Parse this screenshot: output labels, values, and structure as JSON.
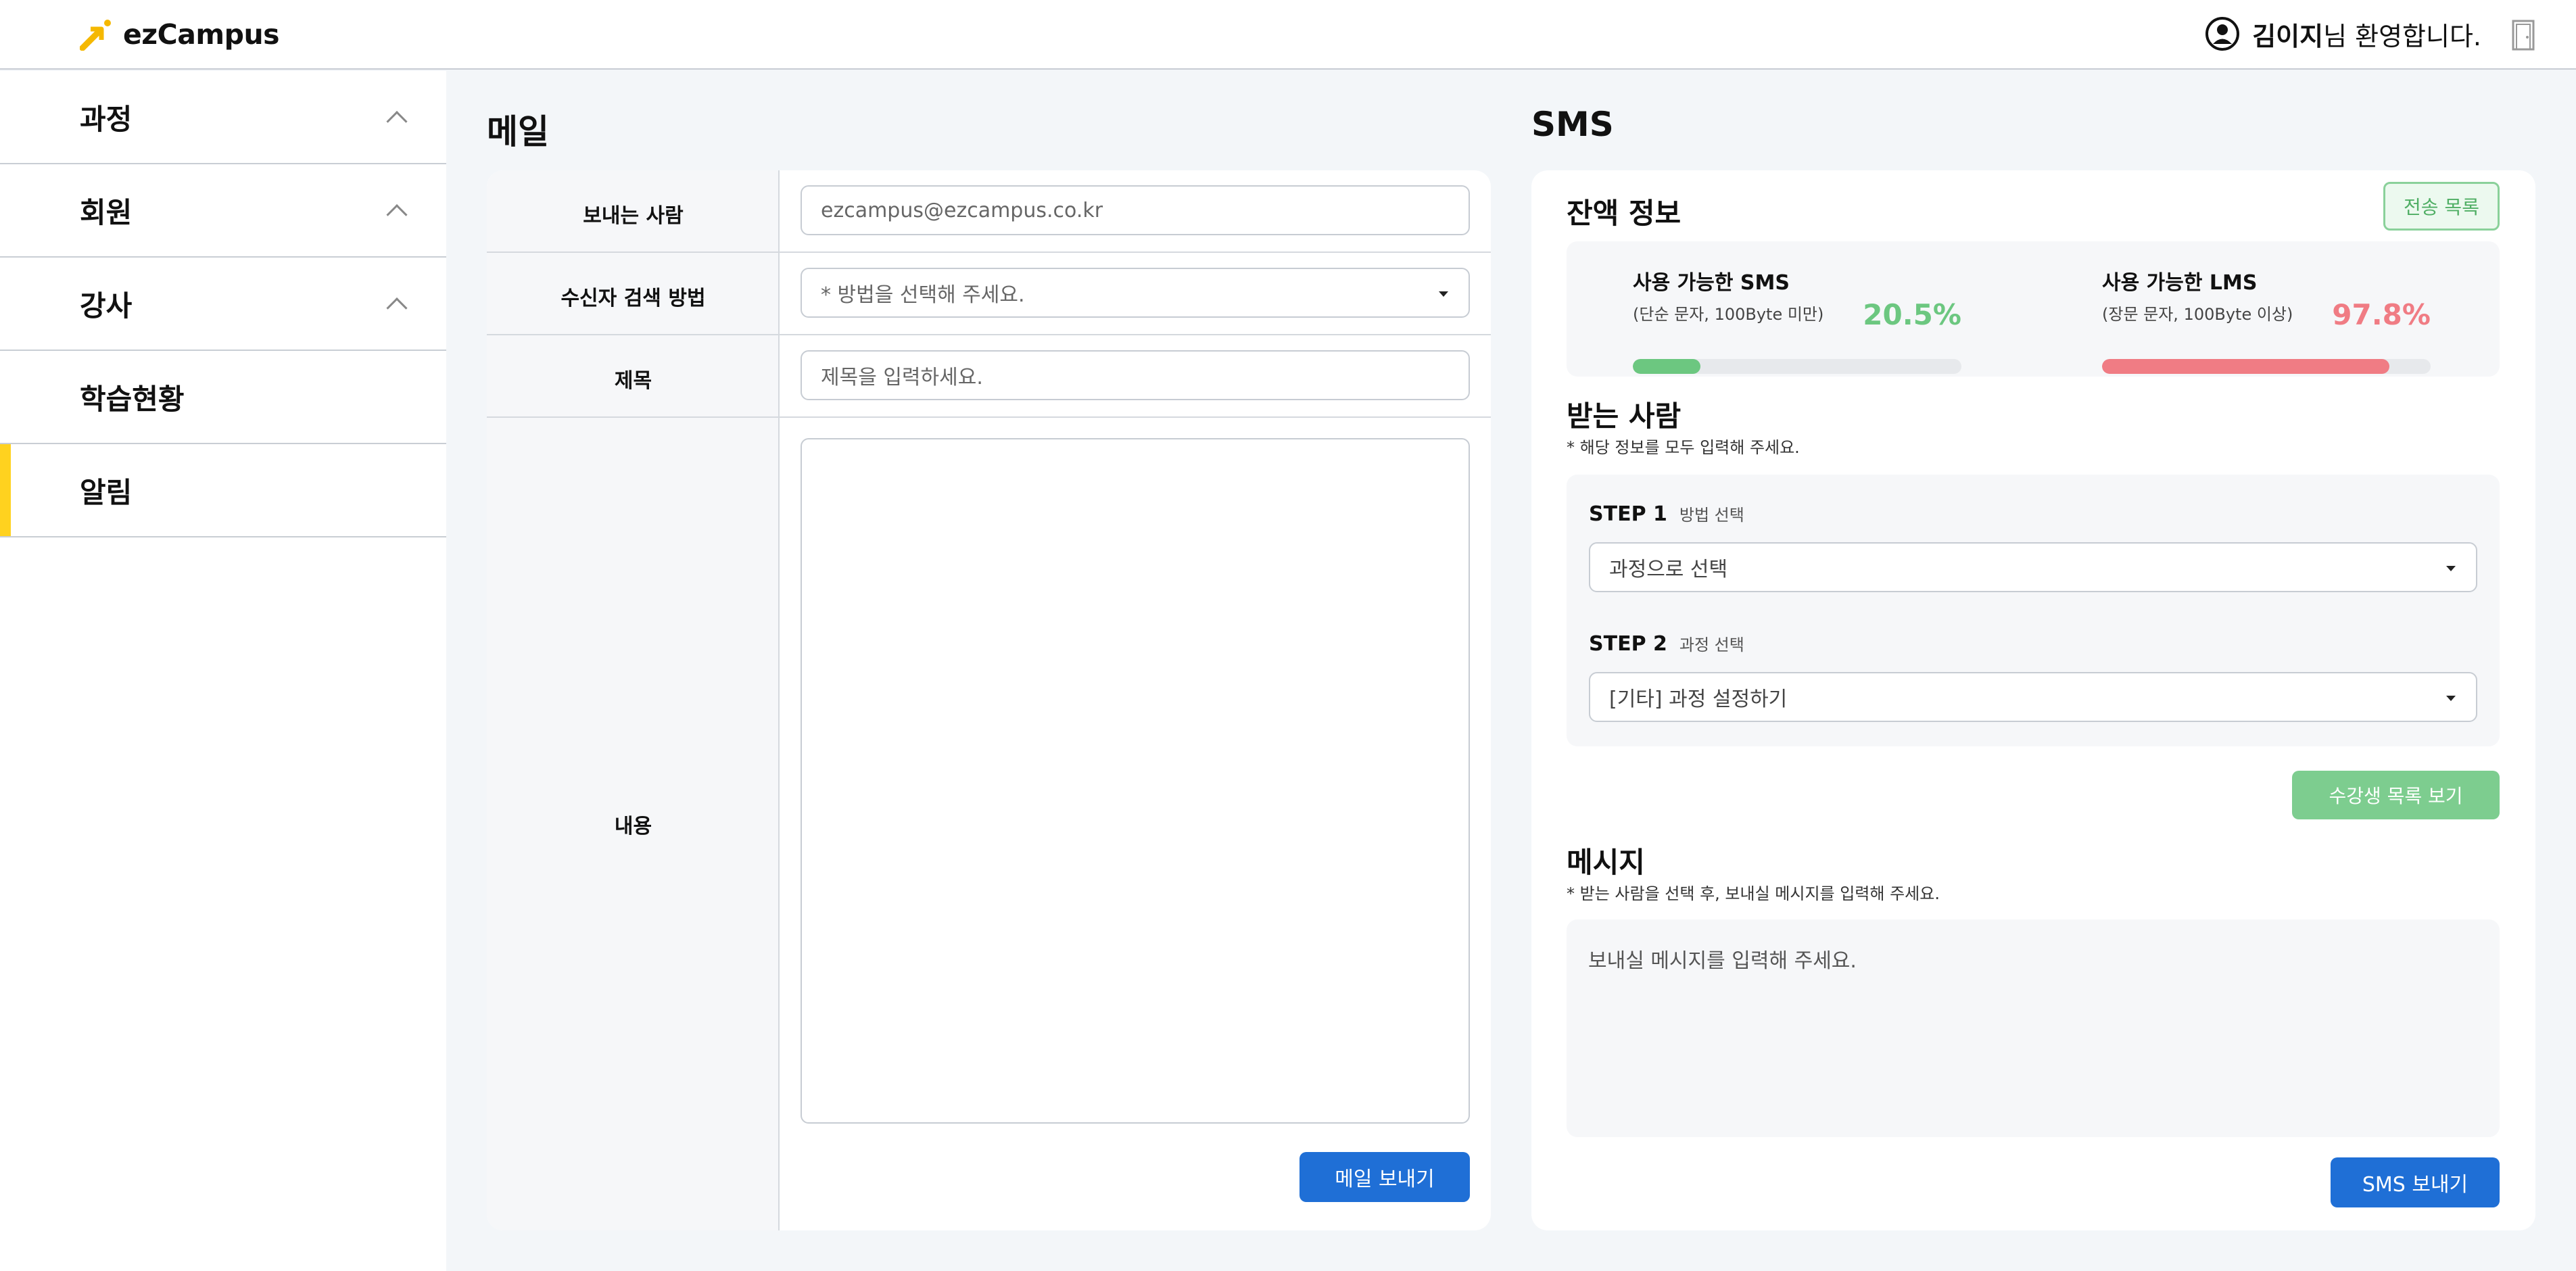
{
  "header": {
    "logo_text": "ezCampus",
    "user_name": "김이지",
    "welcome_suffix": "님 환영합니다."
  },
  "sidebar": {
    "items": [
      {
        "label": "과정"
      },
      {
        "label": "회원"
      },
      {
        "label": "강사"
      },
      {
        "label": "학습현황"
      },
      {
        "label": "알림"
      }
    ],
    "active_item": "알림"
  },
  "mail": {
    "title": "메일",
    "sender_label": "보내는 사람",
    "sender_value": "ezcampus@ezcampus.co.kr",
    "search_method_label": "수신자 검색 방법",
    "search_method_placeholder": "* 방법을 선택해 주세요.",
    "subject_label": "제목",
    "subject_placeholder": "제목을 입력하세요.",
    "content_label": "내용",
    "content_value": "",
    "send_button": "메일 보내기"
  },
  "sms": {
    "title": "SMS",
    "balance_title": "잔액 정보",
    "history_button": "전송 목록",
    "balance": [
      {
        "title": "사용 가능한 SMS",
        "sub": "(단순 문자, 100Byte 미만)",
        "percent_label": "20.5%",
        "percent": 20.5,
        "color": "#6cc780"
      },
      {
        "title": "사용 가능한 LMS",
        "sub": "(장문 문자, 100Byte 이상)",
        "percent_label": "97.8%",
        "percent": 87.5,
        "color": "#f07c84"
      }
    ],
    "recipient_title": "받는 사람",
    "recipient_note": "* 해당 정보를 모두 입력해 주세요.",
    "step1_label": "STEP 1",
    "step1_desc": "방법 선택",
    "step1_value": "과정으로 선택",
    "step2_label": "STEP 2",
    "step2_desc": "과정 선택",
    "step2_value": "[기타] 과정 설정하기",
    "student_list_button": "수강생 목록 보기",
    "message_title": "메시지",
    "message_note": "* 받는 사람을 선택 후, 보내실 메시지를 입력해 주세요.",
    "message_placeholder": "보내실 메시지를 입력해 주세요.",
    "send_button": "SMS 보내기"
  },
  "colors": {
    "accent_blue": "#1f6fd6",
    "active_indicator": "#ffd21f",
    "green": "#6cc780",
    "red": "#f07c84"
  }
}
